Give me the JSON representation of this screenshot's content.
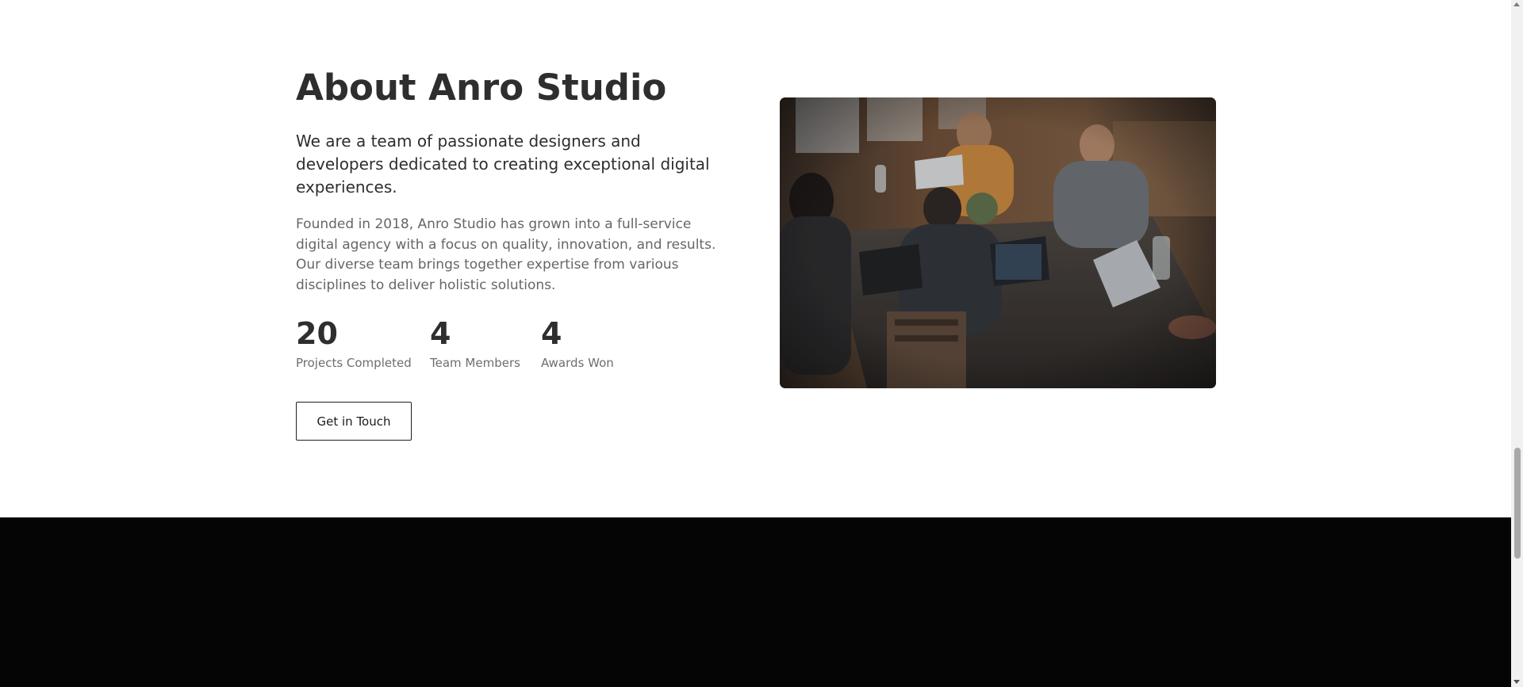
{
  "about": {
    "title": "About Anro Studio",
    "lead": "We are a team of passionate designers and developers dedicated to creating exceptional digital experiences.",
    "body": "Founded in 2018, Anro Studio has grown into a full-service digital agency with a focus on quality, innovation, and results. Our diverse team brings together expertise from various disciplines to deliver holistic solutions.",
    "stats": [
      {
        "value": "20",
        "label": "Projects Completed"
      },
      {
        "value": "4",
        "label": "Team Members"
      },
      {
        "value": "4",
        "label": "Awards Won"
      }
    ],
    "cta_label": "Get in Touch",
    "image_alt": "team-working-at-laptops-photo"
  },
  "colors": {
    "title": "#2e2e2e",
    "body": "#666666",
    "footer_bg": "#050505"
  }
}
